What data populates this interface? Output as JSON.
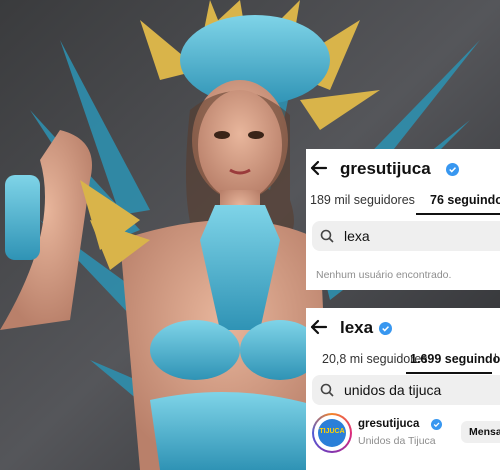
{
  "colors": {
    "accent_verified": "#3897f0",
    "panel_bg": "#ffffff",
    "search_bg": "#efefef"
  },
  "panel_top": {
    "username": "gresutijuca",
    "tabs": {
      "followers": "189 mil seguidores",
      "following": "76 seguindo"
    },
    "search_query": "lexa",
    "empty_message": "Nenhum usuário encontrado."
  },
  "panel_bottom": {
    "username": "lexa",
    "tabs": {
      "followers": "20,8 mi seguidores",
      "following": "1.699 seguindo",
      "extra": "l"
    },
    "search_query": "unidos da tijuca",
    "result": {
      "username": "gresutijuca",
      "display_name": "Unidos da Tijuca",
      "avatar_text": "TIJUCA",
      "button_label": "Mensa"
    }
  },
  "icons": [
    "back-arrow-icon",
    "verified-icon",
    "search-icon"
  ]
}
